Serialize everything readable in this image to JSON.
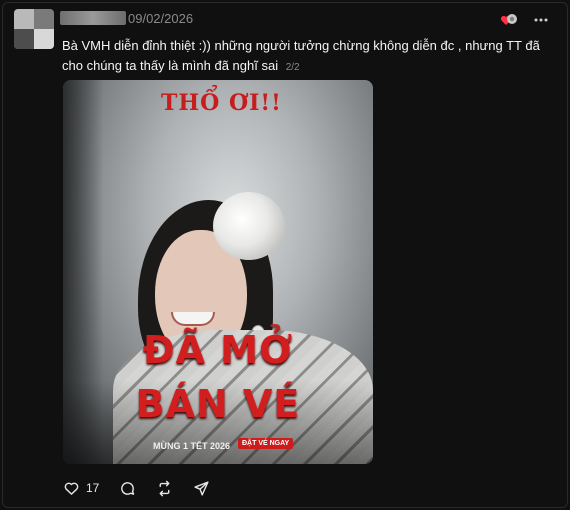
{
  "post": {
    "timestamp": "09/02/2026",
    "text": "Bà VMH diễn đỉnh thiệt :)) những người tưởng chừng không diễn đc , nhưng TT đã cho chúng ta thấy là mình đã nghĩ sai",
    "image_counter": "2/2"
  },
  "poster": {
    "top_tag": "THỔ ƠI!!",
    "title_line1": "ĐÃ MỞ",
    "title_line2": "BÁN VÉ",
    "release": "MÙNG 1 TẾT 2026",
    "cta": "ĐẶT VÉ NGAY"
  },
  "actions": {
    "like_count": "17"
  },
  "icons": [
    "avatar",
    "reaction-icon",
    "more-icon",
    "heart-icon",
    "comment-icon",
    "repost-icon",
    "share-icon"
  ],
  "colors": {
    "background": "#101010",
    "text": "#f3f5f7",
    "muted": "#8a8a8a",
    "poster_red": "#d21e1e"
  }
}
